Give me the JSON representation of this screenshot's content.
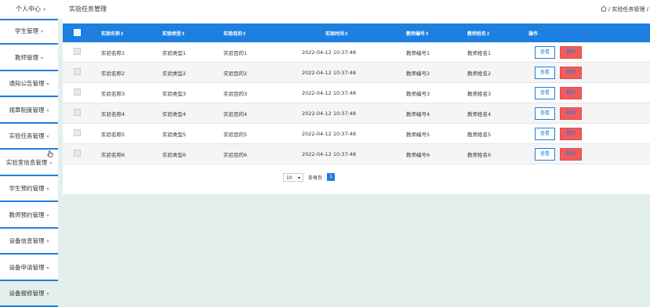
{
  "header": {
    "user_menu": "个人中心",
    "page_title": "实验任务管理",
    "breadcrumb": "/ 实验任务管理 /"
  },
  "sidebar": {
    "items": [
      {
        "label": "学生管理"
      },
      {
        "label": "教师管理"
      },
      {
        "label": "通知公告管理"
      },
      {
        "label": "规章制度管理"
      },
      {
        "label": "实验任务管理"
      },
      {
        "label": "实验室信息管理"
      },
      {
        "label": "学生预约管理"
      },
      {
        "label": "教师预约管理"
      },
      {
        "label": "设备信息管理"
      },
      {
        "label": "设备申请管理"
      },
      {
        "label": "设备报修管理"
      }
    ]
  },
  "table": {
    "columns": [
      "实验名称",
      "实验类型",
      "实验目的",
      "实验时间",
      "教师编号",
      "教师姓名",
      "操作"
    ],
    "sort_mark": "⇕",
    "rows": [
      [
        "实验名称1",
        "实验类型1",
        "实验目的1",
        "2022-04-12 10:37:48",
        "教师编号1",
        "教师姓名1"
      ],
      [
        "实验名称2",
        "实验类型2",
        "实验目的2",
        "2022-04-12 10:37:48",
        "教师编号2",
        "教师姓名2"
      ],
      [
        "实验名称3",
        "实验类型3",
        "实验目的3",
        "2022-04-12 10:37:48",
        "教师编号3",
        "教师姓名3"
      ],
      [
        "实验名称4",
        "实验类型4",
        "实验目的4",
        "2022-04-12 10:37:48",
        "教师编号4",
        "教师姓名4"
      ],
      [
        "实验名称5",
        "实验类型5",
        "实验目的5",
        "2022-04-12 10:37:48",
        "教师编号5",
        "教师姓名5"
      ],
      [
        "实验名称6",
        "实验类型6",
        "实验目的6",
        "2022-04-12 10:37:48",
        "教师编号6",
        "教师姓名6"
      ]
    ],
    "view_label": "查看",
    "delete_label": "删除"
  },
  "pagination": {
    "page_size": "10",
    "per_page_label": "条每页",
    "current_page": "1"
  },
  "colors": {
    "accent": "#1d7fe0",
    "danger": "#f35b5b",
    "background": "#e3efec"
  },
  "icons": {
    "home": "home-icon",
    "caret": "chevron-down-icon",
    "cursor": "hand-pointer-icon"
  }
}
